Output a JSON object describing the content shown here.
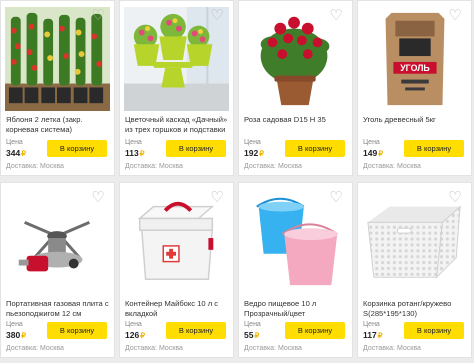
{
  "ui": {
    "price_label": "Цена",
    "currency_symbol": "₽",
    "cart_button": "В корзину",
    "delivery": "Доставка: Москва",
    "favorite_icon": "heart-outline-icon",
    "accent_color": "#ffdd00"
  },
  "products": [
    {
      "title": "Яблоня 2 летка (закр. корневая система)",
      "price": "344",
      "image": "apple-tree-seedlings"
    },
    {
      "title": "Цветочный каскад «Дачный» из трех горшков и подставки",
      "price": "113",
      "image": "flower-pot-cascade"
    },
    {
      "title": "Роза садовая D15 H 35",
      "price": "192",
      "image": "potted-rose"
    },
    {
      "title": "Уголь древесный 5кг",
      "price": "149",
      "image": "charcoal-bag"
    },
    {
      "title": "Портативная газовая плита с пьезоподжигом 12 см",
      "price": "380",
      "image": "portable-gas-stove"
    },
    {
      "title": "Контейнер Майбокс 10 л с вкладкой",
      "price": "126",
      "image": "first-aid-container"
    },
    {
      "title": "Ведро пищевое 10 л Прозрачный/цвет",
      "price": "55",
      "image": "plastic-buckets"
    },
    {
      "title": "Корзинка ротанг/кружево S(285*195*130)",
      "price": "117",
      "image": "rattan-basket"
    }
  ]
}
